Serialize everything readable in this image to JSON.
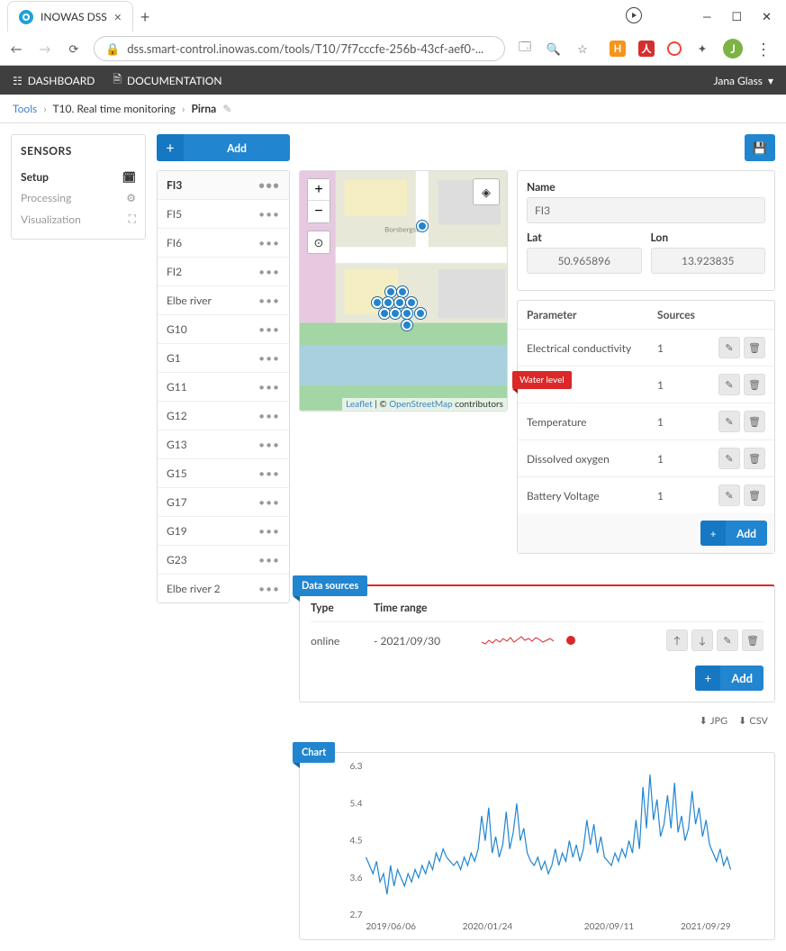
{
  "browser": {
    "tab_title": "INOWAS DSS",
    "url": "dss.smart-control.inowas.com/tools/T10/7f7cccfe-256b-43cf-aef0-...",
    "avatar_initial": "J"
  },
  "topnav": {
    "dashboard": "DASHBOARD",
    "documentation": "DOCUMENTATION",
    "user": "Jana Glass"
  },
  "breadcrumb": {
    "root": "Tools",
    "tool": "T10. Real time monitoring",
    "current": "Pirna"
  },
  "sidebar": {
    "title": "SENSORS",
    "items": [
      {
        "label": "Setup",
        "icon": "calendar",
        "active": true
      },
      {
        "label": "Processing",
        "icon": "cog",
        "active": false
      },
      {
        "label": "Visualization",
        "icon": "expand",
        "active": false
      }
    ]
  },
  "add_button": "Add",
  "sensors": [
    {
      "label": "FI3",
      "active": true
    },
    {
      "label": "FI5"
    },
    {
      "label": "FI6"
    },
    {
      "label": "FI2"
    },
    {
      "label": "Elbe river"
    },
    {
      "label": "G10"
    },
    {
      "label": "G1"
    },
    {
      "label": "G11"
    },
    {
      "label": "G12"
    },
    {
      "label": "G13"
    },
    {
      "label": "G15"
    },
    {
      "label": "G17"
    },
    {
      "label": "G19"
    },
    {
      "label": "G23"
    },
    {
      "label": "Elbe river 2"
    }
  ],
  "map": {
    "attribution_leaflet": "Leaflet",
    "attribution_osm": "OpenStreetMap",
    "attribution_suffix": " contributors",
    "street_label": "Borsbergstr"
  },
  "properties": {
    "name_label": "Name",
    "name_value": "FI3",
    "lat_label": "Lat",
    "lat_value": "50.965896",
    "lon_label": "Lon",
    "lon_value": "13.923835"
  },
  "parameters": {
    "header_param": "Parameter",
    "header_sources": "Sources",
    "rows": [
      {
        "name": "Electrical conductivity",
        "sources": "1"
      },
      {
        "name": "Water level",
        "sources": "1",
        "flag": true
      },
      {
        "name": "Temperature",
        "sources": "1"
      },
      {
        "name": "Dissolved oxygen",
        "sources": "1"
      },
      {
        "name": "Battery Voltage",
        "sources": "1"
      }
    ],
    "add": "Add"
  },
  "datasources": {
    "title": "Data sources",
    "header_type": "Type",
    "header_range": "Time range",
    "rows": [
      {
        "type": "online",
        "range": "- 2021/09/30"
      }
    ],
    "add": "Add"
  },
  "chart": {
    "title": "Chart",
    "export_jpg": "JPG",
    "export_csv": "CSV"
  },
  "chart_data": {
    "type": "line",
    "xlabel": "",
    "ylabel": "",
    "ylim": [
      2.7,
      6.3
    ],
    "y_ticks": [
      2.7,
      3.6,
      4.5,
      5.4,
      6.3
    ],
    "x_ticks": [
      "2019/06/06",
      "2020/01/24",
      "2020/09/11",
      "2021/09/29"
    ],
    "series": [
      {
        "name": "Water level",
        "color": "#2185d0",
        "values": [
          4.1,
          3.9,
          3.7,
          4.0,
          3.5,
          3.7,
          3.2,
          3.9,
          3.4,
          3.8,
          3.6,
          3.4,
          3.7,
          3.5,
          3.8,
          3.6,
          3.9,
          3.7,
          4.0,
          3.8,
          4.2,
          4.0,
          4.3,
          4.1,
          4.0,
          3.9,
          4.0,
          3.8,
          4.1,
          3.9,
          4.2,
          4.0,
          4.3,
          5.1,
          4.5,
          5.3,
          4.2,
          4.6,
          4.1,
          4.4,
          5.2,
          4.3,
          4.7,
          5.4,
          4.5,
          4.8,
          4.2,
          4.0,
          3.9,
          4.1,
          3.8,
          4.0,
          3.7,
          3.9,
          4.3,
          3.9,
          4.2,
          4.0,
          4.5,
          4.1,
          4.4,
          4.0,
          4.3,
          5.0,
          4.4,
          4.9,
          4.2,
          4.6,
          4.1,
          4.0,
          3.9,
          4.2,
          4.0,
          4.3,
          4.1,
          4.5,
          4.2,
          5.0,
          4.3,
          5.8,
          4.8,
          6.1,
          5.0,
          5.5,
          4.6,
          4.9,
          5.6,
          4.8,
          5.9,
          4.7,
          5.1,
          4.5,
          4.8,
          5.7,
          4.9,
          5.3,
          4.6,
          5.0,
          4.4,
          4.2,
          4.0,
          4.3,
          3.9,
          4.1,
          3.8
        ]
      }
    ]
  }
}
